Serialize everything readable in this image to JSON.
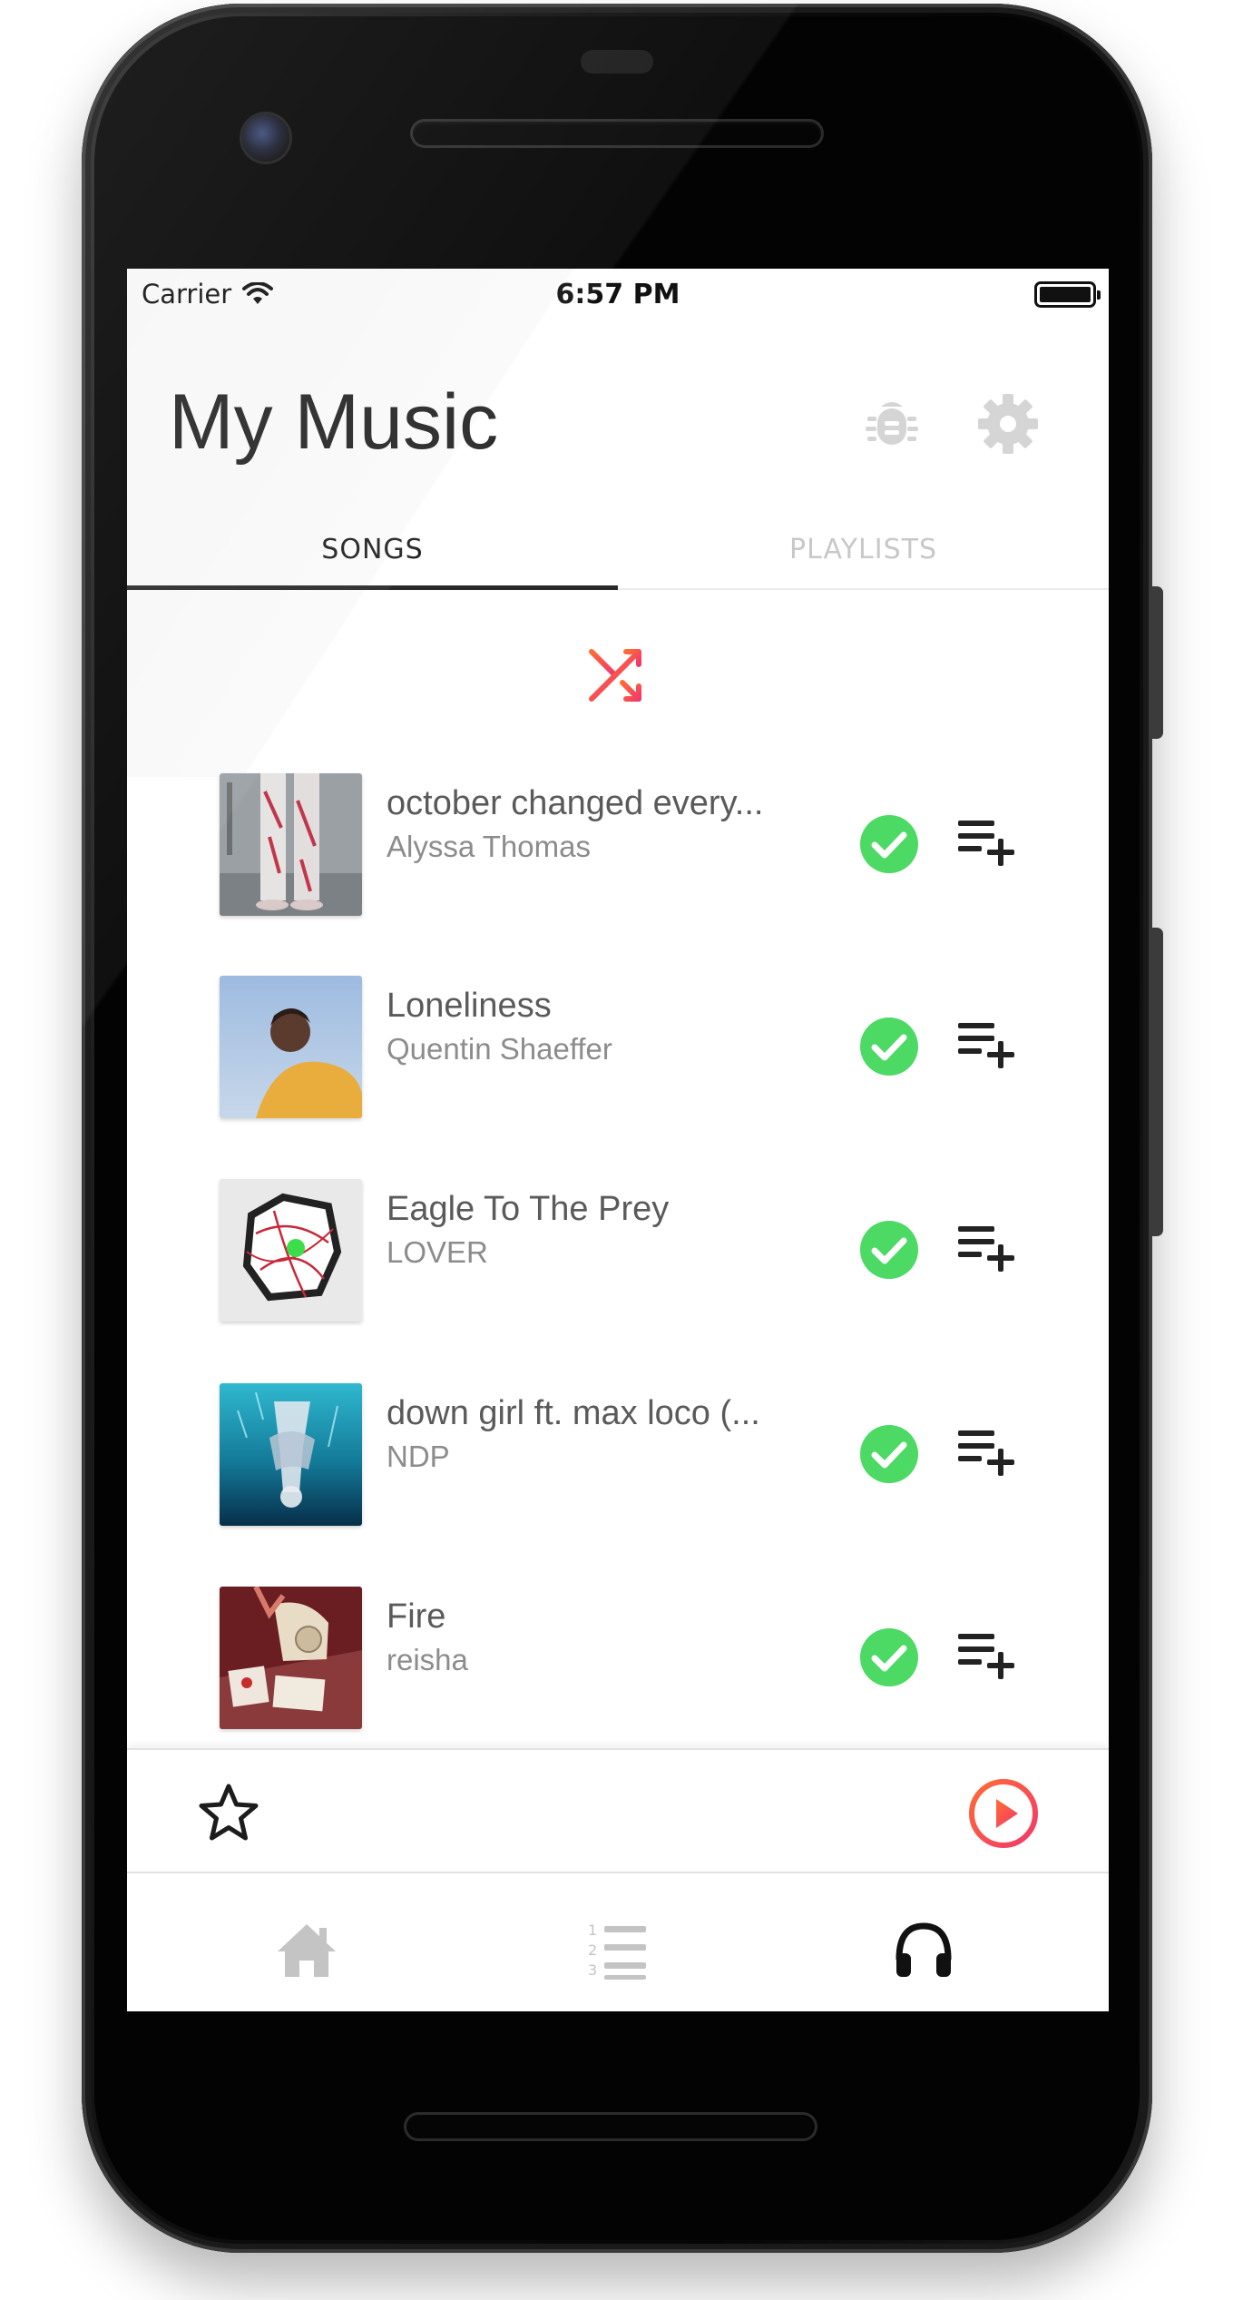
{
  "status_bar": {
    "carrier": "Carrier",
    "time": "6:57 PM",
    "wifi_icon": "wifi-icon",
    "battery_icon": "battery-icon"
  },
  "header": {
    "title": "My Music",
    "bug_icon": "bug-icon",
    "settings_icon": "gear-icon",
    "icon_color": "#d5d5d5"
  },
  "tabs": [
    {
      "label": "SONGS",
      "active": true
    },
    {
      "label": "PLAYLISTS",
      "active": false
    }
  ],
  "shuffle_icon": "shuffle-icon",
  "songs": [
    {
      "title": "october changed every...",
      "artist": "Alyssa Thomas",
      "downloaded": true,
      "art": "pale-legs-cover"
    },
    {
      "title": "Loneliness",
      "artist": "Quentin Shaeffer",
      "downloaded": true,
      "art": "yellow-jacket-cover"
    },
    {
      "title": "Eagle To The Prey",
      "artist": "LOVER",
      "downloaded": true,
      "art": "torn-paper-cover"
    },
    {
      "title": "down girl ft. max loco (...",
      "artist": "NDP",
      "downloaded": true,
      "art": "underwater-cover"
    },
    {
      "title": "Fire",
      "artist": "reisha",
      "downloaded": true,
      "art": "rotary-phone-cover"
    }
  ],
  "player": {
    "favorite_icon": "star-icon",
    "play_icon": "play-circle-icon"
  },
  "bottom_nav": [
    {
      "name": "home",
      "icon": "home-icon",
      "active": false
    },
    {
      "name": "list",
      "icon": "numbered-list-icon",
      "active": false
    },
    {
      "name": "music",
      "icon": "headphones-icon",
      "active": true
    }
  ],
  "colors": {
    "accent_start": "#ff6b35",
    "accent_end": "#f2386b",
    "check_green": "#4cd964",
    "title_text": "#262626"
  }
}
